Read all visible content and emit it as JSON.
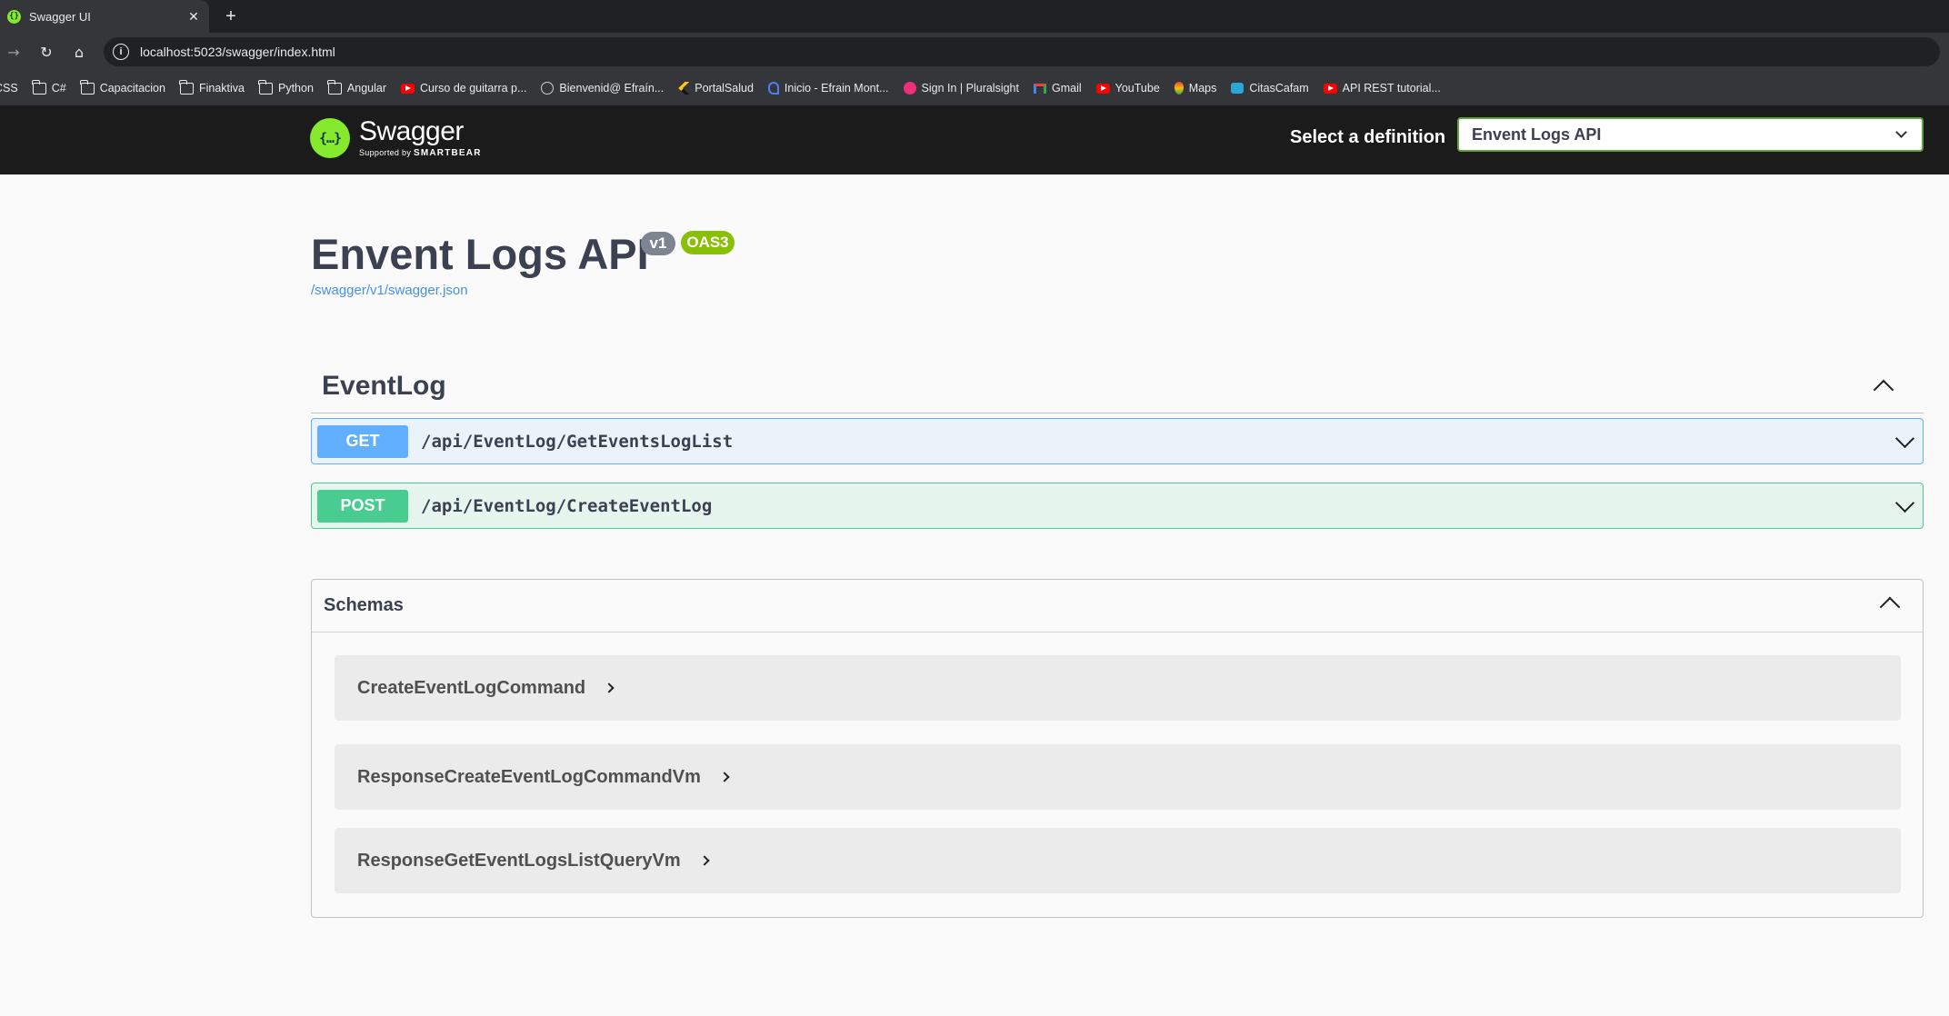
{
  "browser": {
    "tab_title": "Swagger UI",
    "tab_close": "✕",
    "new_tab": "+",
    "favicon": "swagger-favicon",
    "url": "localhost:5023/swagger/index.html",
    "bookmarks": [
      {
        "label": "CSS",
        "icon": "none"
      },
      {
        "label": "C#",
        "icon": "folder"
      },
      {
        "label": "Capacitacion",
        "icon": "folder"
      },
      {
        "label": "Finaktiva",
        "icon": "folder"
      },
      {
        "label": "Python",
        "icon": "folder"
      },
      {
        "label": "Angular",
        "icon": "folder"
      },
      {
        "label": "Curso de guitarra p...",
        "icon": "yt"
      },
      {
        "label": "Bienvenid@ Efraín...",
        "icon": "globe"
      },
      {
        "label": "PortalSalud",
        "icon": "chev"
      },
      {
        "label": "Inicio - Efrain Mont...",
        "icon": "helix"
      },
      {
        "label": "Sign In | Pluralsight",
        "icon": "ps"
      },
      {
        "label": "Gmail",
        "icon": "gm"
      },
      {
        "label": "YouTube",
        "icon": "yt"
      },
      {
        "label": "Maps",
        "icon": "map"
      },
      {
        "label": "CitasCafam",
        "icon": "citas"
      },
      {
        "label": "API REST tutorial...",
        "icon": "yt"
      }
    ]
  },
  "topbar": {
    "logo_name": "Swagger",
    "logo_sub_prefix": "Supported by",
    "logo_sub_brand": "SMARTBEAR",
    "definition_label": "Select a definition",
    "definition_selected": "Envent Logs API"
  },
  "info": {
    "title": "Envent Logs API",
    "version_badge": "v1",
    "oas_badge": "OAS3",
    "spec_link": "/swagger/v1/swagger.json"
  },
  "tag": {
    "name": "EventLog",
    "operations": [
      {
        "method": "GET",
        "path": "/api/EventLog/GetEventsLogList"
      },
      {
        "method": "POST",
        "path": "/api/EventLog/CreateEventLog"
      }
    ]
  },
  "schemas": {
    "title": "Schemas",
    "models": [
      "CreateEventLogCommand",
      "ResponseCreateEventLogCommandVm",
      "ResponseGetEventLogsListQueryVm"
    ]
  },
  "colors": {
    "swagger_green": "#85ea2d",
    "get": "#61affe",
    "post": "#49cc90",
    "link": "#4990e2"
  }
}
